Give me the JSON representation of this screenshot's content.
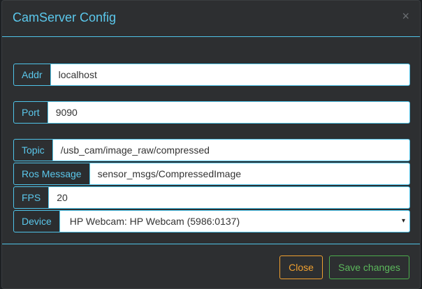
{
  "dialog": {
    "title": "CamServer Config",
    "close_glyph": "×",
    "close_icon": "close-icon"
  },
  "fields": {
    "addr": {
      "label": "Addr",
      "value": "localhost"
    },
    "port": {
      "label": "Port",
      "value": "9090"
    },
    "topic": {
      "label": "Topic",
      "value": "/usb_cam/image_raw/compressed"
    },
    "ros_message": {
      "label": "Ros Message",
      "value": "sensor_msgs/CompressedImage"
    },
    "fps": {
      "label": "FPS",
      "value": "20"
    },
    "device": {
      "label": "Device",
      "value": "HP Webcam: HP Webcam (5986:0137)",
      "caret": "▾"
    }
  },
  "footer": {
    "close_label": "Close",
    "save_label": "Save changes"
  },
  "colors": {
    "accent": "#4fc3e8",
    "close_button": "#f0a030",
    "save_button": "#5cb85c",
    "background": "#2d2f31"
  }
}
